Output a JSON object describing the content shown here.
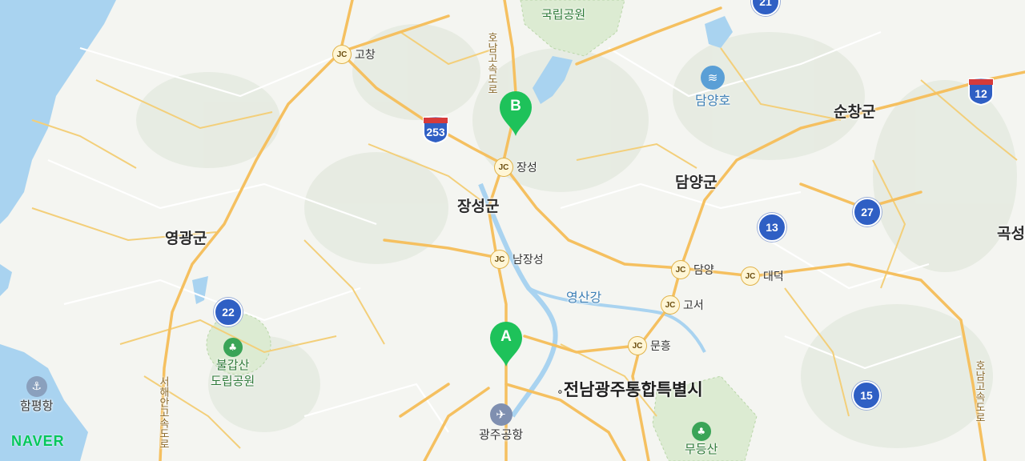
{
  "map": {
    "regions": {
      "yeonggwang": "영광군",
      "jangseong": "장성군",
      "damyang": "담양군",
      "sunchang": "순창군",
      "gokseong_partial": "곡성",
      "gwangju": "전남광주통합특별시"
    },
    "water": {
      "yeongsan_river": "영산강",
      "damyang_lake": "담양호"
    },
    "parks": {
      "national_park_top": "국립공원",
      "bulgapsan": "불갑산\n도립공원",
      "mudeungsan": "무등산"
    },
    "places": {
      "hampyeong_port": "함평항",
      "gwangju_airport": "광주공항"
    },
    "junctions": [
      {
        "badge": "JC",
        "name": "고창"
      },
      {
        "badge": "JC",
        "name": "장성"
      },
      {
        "badge": "JC",
        "name": "남장성"
      },
      {
        "badge": "JC",
        "name": "담양"
      },
      {
        "badge": "JC",
        "name": "대덕"
      },
      {
        "badge": "JC",
        "name": "고서"
      },
      {
        "badge": "JC",
        "name": "문흥"
      }
    ],
    "route_shields": [
      "22",
      "13",
      "27",
      "15",
      "21"
    ],
    "highway_shields": [
      "253",
      "12"
    ],
    "road_names": {
      "honam_expressway": "호남고속도로",
      "seohaean_expressway": "서해안고속도로",
      "east_expressway": "호남고속도로"
    },
    "markers": {
      "start": "A",
      "end": "B"
    },
    "logo": "NAVER"
  },
  "colors": {
    "land": "#f4f5f1",
    "sea": "#a9d3f0",
    "road_major": "#f5c060",
    "marker": "#1ec25a",
    "shield_blue": "#2f5fc4",
    "park_green": "#dcebd2"
  }
}
